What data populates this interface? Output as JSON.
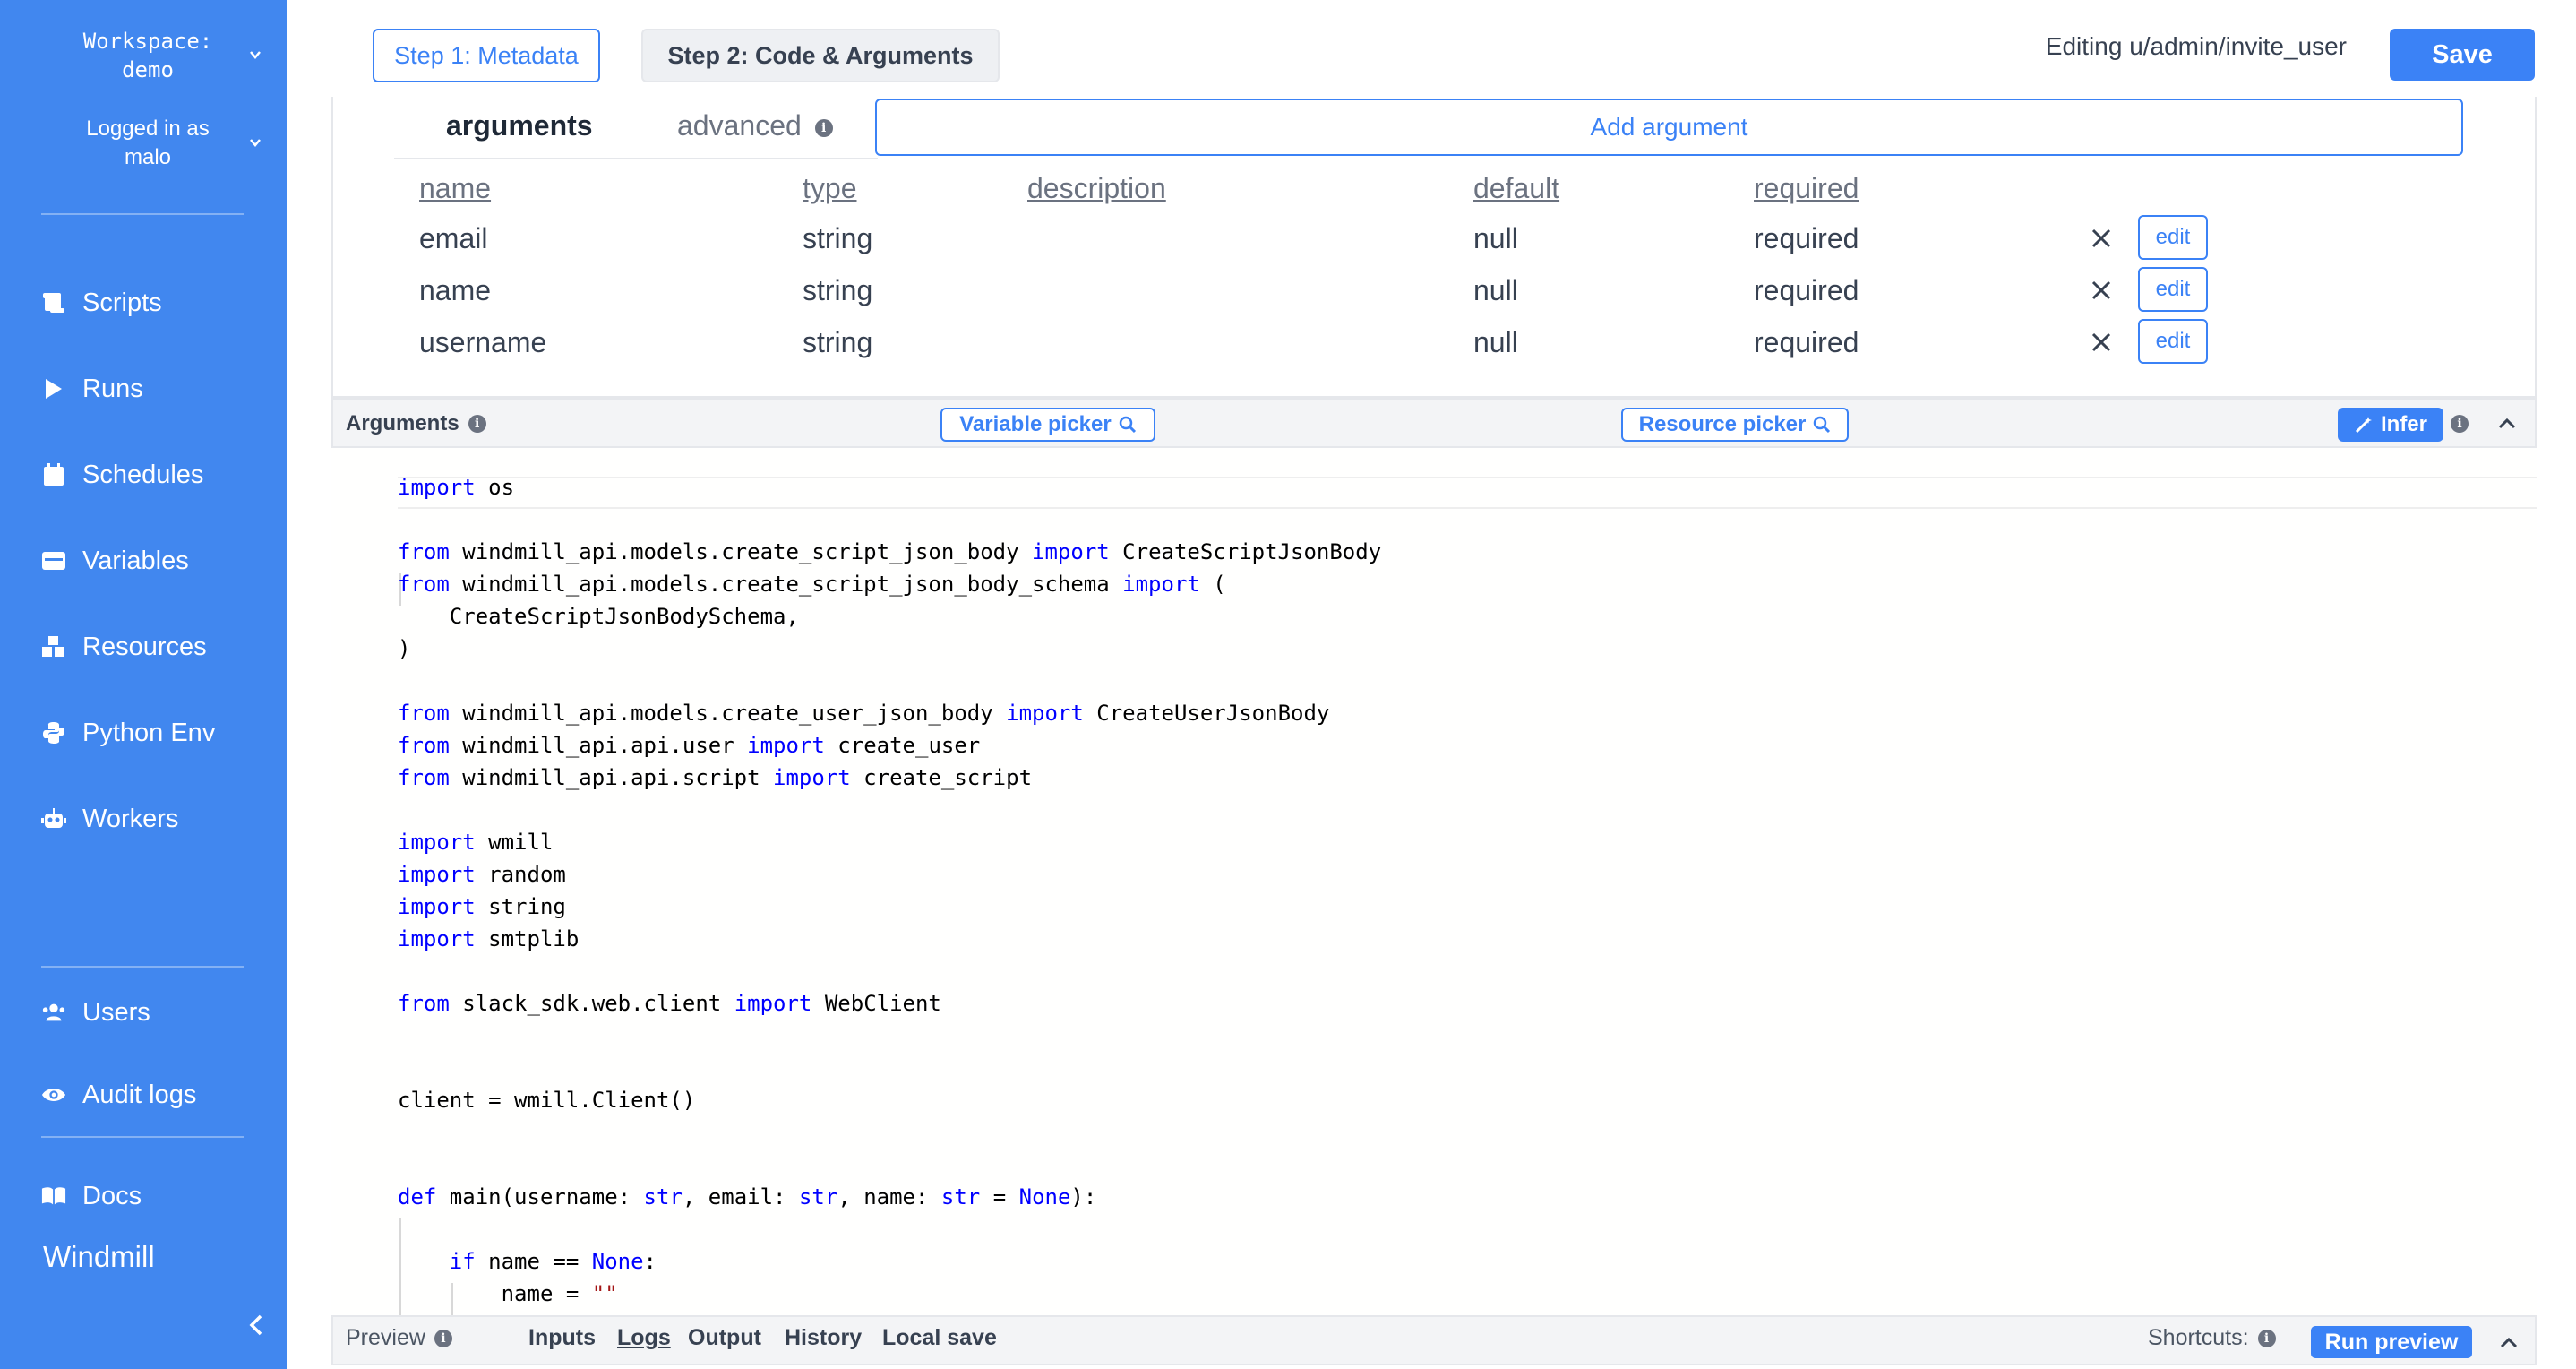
{
  "sidebar": {
    "workspace_label": "Workspace:",
    "workspace_name": "demo",
    "logged_in_label": "Logged in as",
    "user_name": "malo",
    "items": [
      {
        "label": "Scripts",
        "icon": "script-icon"
      },
      {
        "label": "Runs",
        "icon": "play-icon"
      },
      {
        "label": "Schedules",
        "icon": "calendar-icon"
      },
      {
        "label": "Variables",
        "icon": "variable-icon"
      },
      {
        "label": "Resources",
        "icon": "cubes-icon"
      },
      {
        "label": "Python Env",
        "icon": "python-icon"
      },
      {
        "label": "Workers",
        "icon": "robot-icon"
      },
      {
        "label": "Users",
        "icon": "users-icon"
      },
      {
        "label": "Audit logs",
        "icon": "eye-icon"
      },
      {
        "label": "Docs",
        "icon": "book-icon"
      }
    ],
    "brand": "Windmill"
  },
  "header": {
    "step1_label": "Step 1: Metadata",
    "step2_label": "Step 2: Code & Arguments",
    "editing_label": "Editing u/admin/invite_user",
    "save_label": "Save"
  },
  "arguments_panel": {
    "tab_arguments": "arguments",
    "tab_advanced": "advanced",
    "add_argument_label": "Add argument",
    "columns": [
      "name",
      "type",
      "description",
      "default",
      "required"
    ],
    "rows": [
      {
        "name": "email",
        "type": "string",
        "description": "",
        "default": "null",
        "required": "required",
        "edit": "edit"
      },
      {
        "name": "name",
        "type": "string",
        "description": "",
        "default": "null",
        "required": "required",
        "edit": "edit"
      },
      {
        "name": "username",
        "type": "string",
        "description": "",
        "default": "null",
        "required": "required",
        "edit": "edit"
      }
    ]
  },
  "editor_toolbar": {
    "title": "Arguments",
    "variable_picker": "Variable picker",
    "resource_picker": "Resource picker",
    "infer": "Infer"
  },
  "code_lines": [
    [
      {
        "t": "import",
        "k": "kw"
      },
      {
        "t": " os"
      }
    ],
    [],
    [
      {
        "t": "from",
        "k": "kw"
      },
      {
        "t": " windmill_api.models.create_script_json_body "
      },
      {
        "t": "import",
        "k": "kw"
      },
      {
        "t": " CreateScriptJsonBody"
      }
    ],
    [
      {
        "t": "from",
        "k": "kw"
      },
      {
        "t": " windmill_api.models.create_script_json_body_schema "
      },
      {
        "t": "import",
        "k": "kw"
      },
      {
        "t": " ("
      }
    ],
    [
      {
        "t": "    CreateScriptJsonBodySchema,"
      }
    ],
    [
      {
        "t": ")"
      }
    ],
    [],
    [
      {
        "t": "from",
        "k": "kw"
      },
      {
        "t": " windmill_api.models.create_user_json_body "
      },
      {
        "t": "import",
        "k": "kw"
      },
      {
        "t": " CreateUserJsonBody"
      }
    ],
    [
      {
        "t": "from",
        "k": "kw"
      },
      {
        "t": " windmill_api.api.user "
      },
      {
        "t": "import",
        "k": "kw"
      },
      {
        "t": " create_user"
      }
    ],
    [
      {
        "t": "from",
        "k": "kw"
      },
      {
        "t": " windmill_api.api.script "
      },
      {
        "t": "import",
        "k": "kw"
      },
      {
        "t": " create_script"
      }
    ],
    [],
    [
      {
        "t": "import",
        "k": "kw"
      },
      {
        "t": " wmill"
      }
    ],
    [
      {
        "t": "import",
        "k": "kw"
      },
      {
        "t": " random"
      }
    ],
    [
      {
        "t": "import",
        "k": "kw"
      },
      {
        "t": " string"
      }
    ],
    [
      {
        "t": "import",
        "k": "kw"
      },
      {
        "t": " smtplib"
      }
    ],
    [],
    [
      {
        "t": "from",
        "k": "kw"
      },
      {
        "t": " slack_sdk.web.client "
      },
      {
        "t": "import",
        "k": "kw"
      },
      {
        "t": " WebClient"
      }
    ],
    [],
    [],
    [
      {
        "t": "client = wmill.Client()"
      }
    ],
    [],
    [],
    [
      {
        "t": "def",
        "k": "kw"
      },
      {
        "t": " main(username: "
      },
      {
        "t": "str",
        "k": "kw"
      },
      {
        "t": ", email: "
      },
      {
        "t": "str",
        "k": "kw"
      },
      {
        "t": ", name: "
      },
      {
        "t": "str",
        "k": "kw"
      },
      {
        "t": " = "
      },
      {
        "t": "None",
        "k": "kw"
      },
      {
        "t": "):"
      }
    ],
    [],
    [
      {
        "t": "    "
      },
      {
        "t": "if",
        "k": "kw"
      },
      {
        "t": " name == "
      },
      {
        "t": "None",
        "k": "kw"
      },
      {
        "t": ":"
      }
    ],
    [
      {
        "t": "        name = "
      },
      {
        "t": "\"\"",
        "k": "str"
      }
    ]
  ],
  "bottom_bar": {
    "preview_label": "Preview",
    "tabs": [
      "Inputs",
      "Logs",
      "Output",
      "History",
      "Local save"
    ],
    "shortcuts_label": "Shortcuts:",
    "run_preview": "Run preview"
  },
  "colors": {
    "sidebar_bg": "#4187ef",
    "accent": "#3b82f6",
    "keyword": "#0000ff",
    "string": "#a31515"
  }
}
